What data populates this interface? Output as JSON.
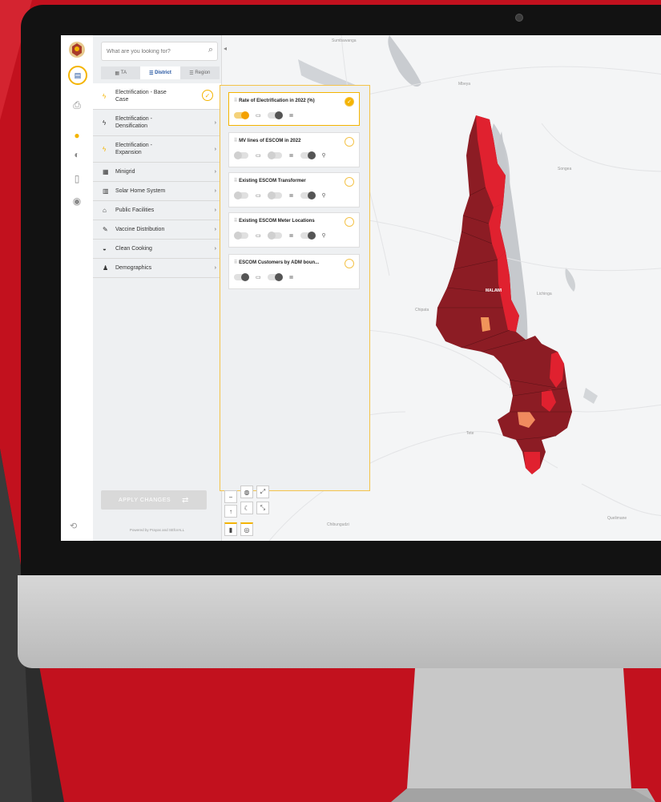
{
  "search": {
    "placeholder": "What are you looking for?"
  },
  "tabs": [
    {
      "label": "TA",
      "icon": "grid-icon"
    },
    {
      "label": "District",
      "icon": "list-icon",
      "active": true
    },
    {
      "label": "Region",
      "icon": "list-icon"
    }
  ],
  "menu": [
    {
      "label1": "Electrification - Base",
      "label2": "Case",
      "icon": "bolt-icon"
    },
    {
      "label1": "Electrification -",
      "label2": "Densification",
      "icon": "bolt-icon"
    },
    {
      "label1": "Electrification -",
      "label2": "Expansion",
      "icon": "bolt-icon"
    },
    {
      "label1": "Minigrid",
      "icon": "grid-icon"
    },
    {
      "label1": "Solar Home System",
      "icon": "solar-panel-icon"
    },
    {
      "label1": "Public Facilities",
      "icon": "building-icon"
    },
    {
      "label1": "Vaccine Distribution",
      "icon": "syringe-icon"
    },
    {
      "label1": "Clean Cooking",
      "icon": "pot-icon"
    },
    {
      "label1": "Demographics",
      "icon": "person-icon"
    }
  ],
  "layers": [
    {
      "title": "Rate of Electrification in 2022 (%)",
      "active": true
    },
    {
      "title": "MV lines of ESCOM in 2022",
      "active": false
    },
    {
      "title": "Existing ESCOM Transformer",
      "active": false
    },
    {
      "title": "Existing ESCOM Meter Locations",
      "active": false
    },
    {
      "title": "ESCOM Customers by ADM boun...",
      "active": false
    }
  ],
  "apply_label": "APPLY CHANGES",
  "powered_by": "Powered by Prayas and SEforALL",
  "map_labels": {
    "mbeya": "Mbeya",
    "songea": "Songea",
    "malawi": "MALAWI",
    "lichinga": "Lichinga",
    "chipata": "Chipata",
    "tete": "Tete",
    "chibungo": "Chibungudzi",
    "quelimane": "Quelimane",
    "sumbawanga": "Sumbawanga"
  },
  "colors": {
    "accent": "#f4b400",
    "brand_red": "#c2111e",
    "dark_red": "#8c1c24",
    "red": "#e0212f"
  }
}
